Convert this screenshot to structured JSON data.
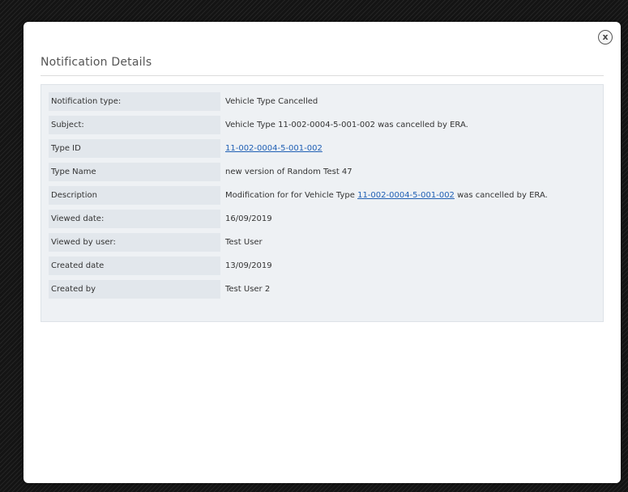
{
  "modal": {
    "title": "Notification Details",
    "close_icon": "close-icon",
    "close_glyph": "x"
  },
  "details": [
    {
      "label": "Notification type:",
      "value": "Vehicle Type Cancelled"
    },
    {
      "label": "Subject:",
      "value": "Vehicle Type 11-002-0004-5-001-002 was cancelled by ERA."
    },
    {
      "label": "Type ID",
      "value_link": "11-002-0004-5-001-002"
    },
    {
      "label": "Type Name",
      "value": "new version of Random Test 47"
    },
    {
      "label": "Description",
      "value_prefix": "Modification for for Vehicle Type ",
      "value_link": "11-002-0004-5-001-002",
      "value_suffix": " was cancelled by ERA."
    },
    {
      "label": "Viewed date:",
      "value": "16/09/2019"
    },
    {
      "label": "Viewed by user:",
      "value": "Test User"
    },
    {
      "label": "Created date",
      "value": "13/09/2019"
    },
    {
      "label": "Created by",
      "value": "Test User 2"
    }
  ],
  "colors": {
    "link": "#1f5fb4",
    "panel_background": "#eef1f4",
    "label_background": "#e2e7ec"
  }
}
